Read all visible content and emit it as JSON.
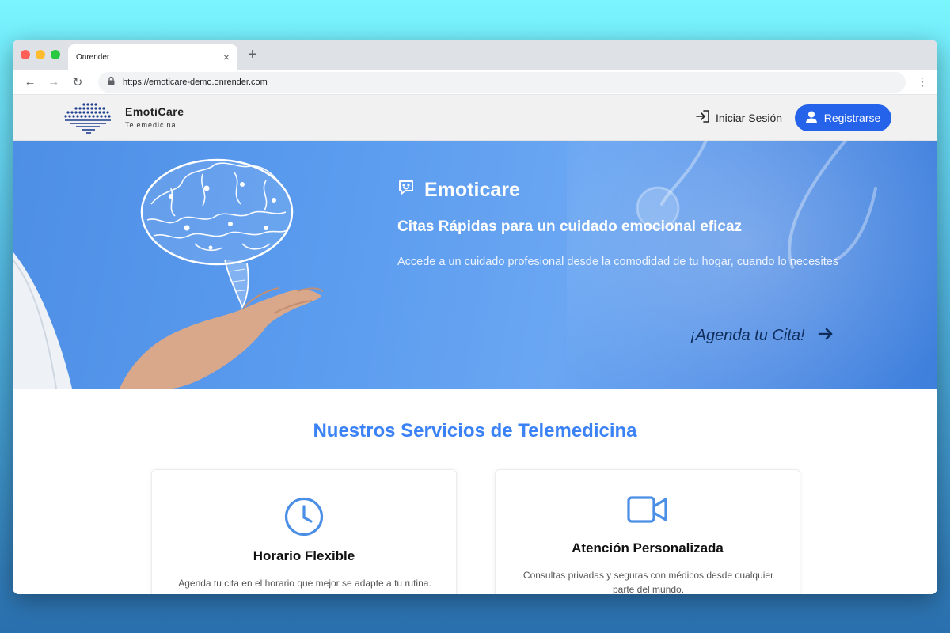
{
  "browser": {
    "tab_title": "Onrender",
    "tab_close": "×",
    "new_tab": "+",
    "back": "←",
    "forward": "→",
    "reload": "↻",
    "url": "https://emoticare-demo.onrender.com",
    "menu": "⋮"
  },
  "header": {
    "brand_name": "EmotiCare",
    "brand_sub": "Telemedicina",
    "login_label": "Iniciar Sesión",
    "register_label": "Registrarse",
    "accent_color": "#2563eb"
  },
  "hero": {
    "title": "Emoticare",
    "subtitle": "Citas Rápidas para un cuidado emocional eficaz",
    "description": "Accede a un cuidado profesional desde la comodidad de tu hogar, cuando lo necesites",
    "cta_label": "¡Agenda tu Cita!"
  },
  "services": {
    "title": "Nuestros Servicios de Telemedicina",
    "cards": [
      {
        "icon": "clock-icon",
        "title": "Horario Flexible",
        "description": "Agenda tu cita en el horario que mejor se adapte a tu rutina."
      },
      {
        "icon": "video-camera-icon",
        "title": "Atención Personalizada",
        "description": "Consultas privadas y seguras con médicos desde cualquier parte del mundo."
      }
    ],
    "accent_color": "#3b82f6"
  }
}
